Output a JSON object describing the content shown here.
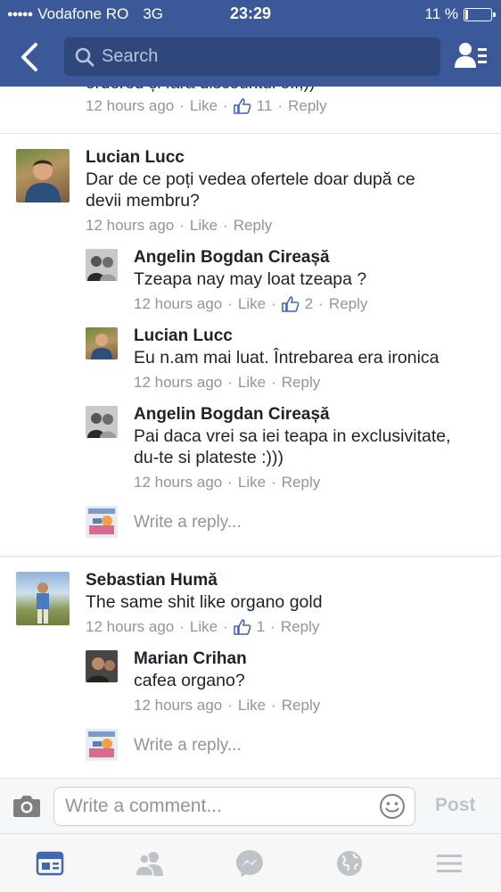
{
  "status_bar": {
    "carrier": "Vodafone RO",
    "network": "3G",
    "time": "23:29",
    "battery": "11 %",
    "battery_level": 0.11
  },
  "nav": {
    "search_placeholder": "Search"
  },
  "top_partial": {
    "text": "ordered și fără discountul off;))",
    "time": "12 hours ago",
    "like": "Like",
    "like_count": "11",
    "reply": "Reply"
  },
  "threads": [
    {
      "name": "Lucian Lucc",
      "text_lines": [
        "Dar de ce poți vedea ofertele doar după ce",
        "devii membru?"
      ],
      "time": "12 hours ago",
      "like": "Like",
      "reply": "Reply",
      "replies": [
        {
          "name": "Angelin Bogdan Cireașă",
          "text_lines": [
            "Tzeapa nay may loat tzeapa ?"
          ],
          "time": "12 hours ago",
          "like": "Like",
          "like_count": "2",
          "reply": "Reply"
        },
        {
          "name": "Lucian Lucc",
          "text_lines": [
            "Eu n.am mai luat. Întrebarea era ironica"
          ],
          "time": "12 hours ago",
          "like": "Like",
          "reply": "Reply"
        },
        {
          "name": "Angelin Bogdan Cireașă",
          "text_lines": [
            "Pai daca vrei sa iei teapa in exclusivitate,",
            "du-te si plateste :)))"
          ],
          "time": "12 hours ago",
          "like": "Like",
          "reply": "Reply"
        }
      ],
      "write_reply": "Write a reply..."
    },
    {
      "name": "Sebastian Humă",
      "text_lines": [
        "The same shit like organo gold"
      ],
      "time": "12 hours ago",
      "like": "Like",
      "like_count": "1",
      "reply": "Reply",
      "replies": [
        {
          "name": "Marian Crihan",
          "text_lines": [
            "cafea organo?"
          ],
          "time": "12 hours ago",
          "like": "Like",
          "reply": "Reply"
        }
      ],
      "write_reply": "Write a reply..."
    }
  ],
  "composer": {
    "placeholder": "Write a comment...",
    "post": "Post"
  },
  "tabs": [
    {
      "icon": "news-feed-icon",
      "active": true
    },
    {
      "icon": "friend-requests-icon",
      "active": false
    },
    {
      "icon": "messenger-icon",
      "active": false
    },
    {
      "icon": "notifications-globe-icon",
      "active": false
    },
    {
      "icon": "menu-icon",
      "active": false
    }
  ],
  "colors": {
    "header": "#3b5998",
    "search_bg": "#2f477a",
    "meta_text": "#90949c",
    "active_tab": "#4267b2",
    "inactive_tab": "#bec3c9"
  }
}
